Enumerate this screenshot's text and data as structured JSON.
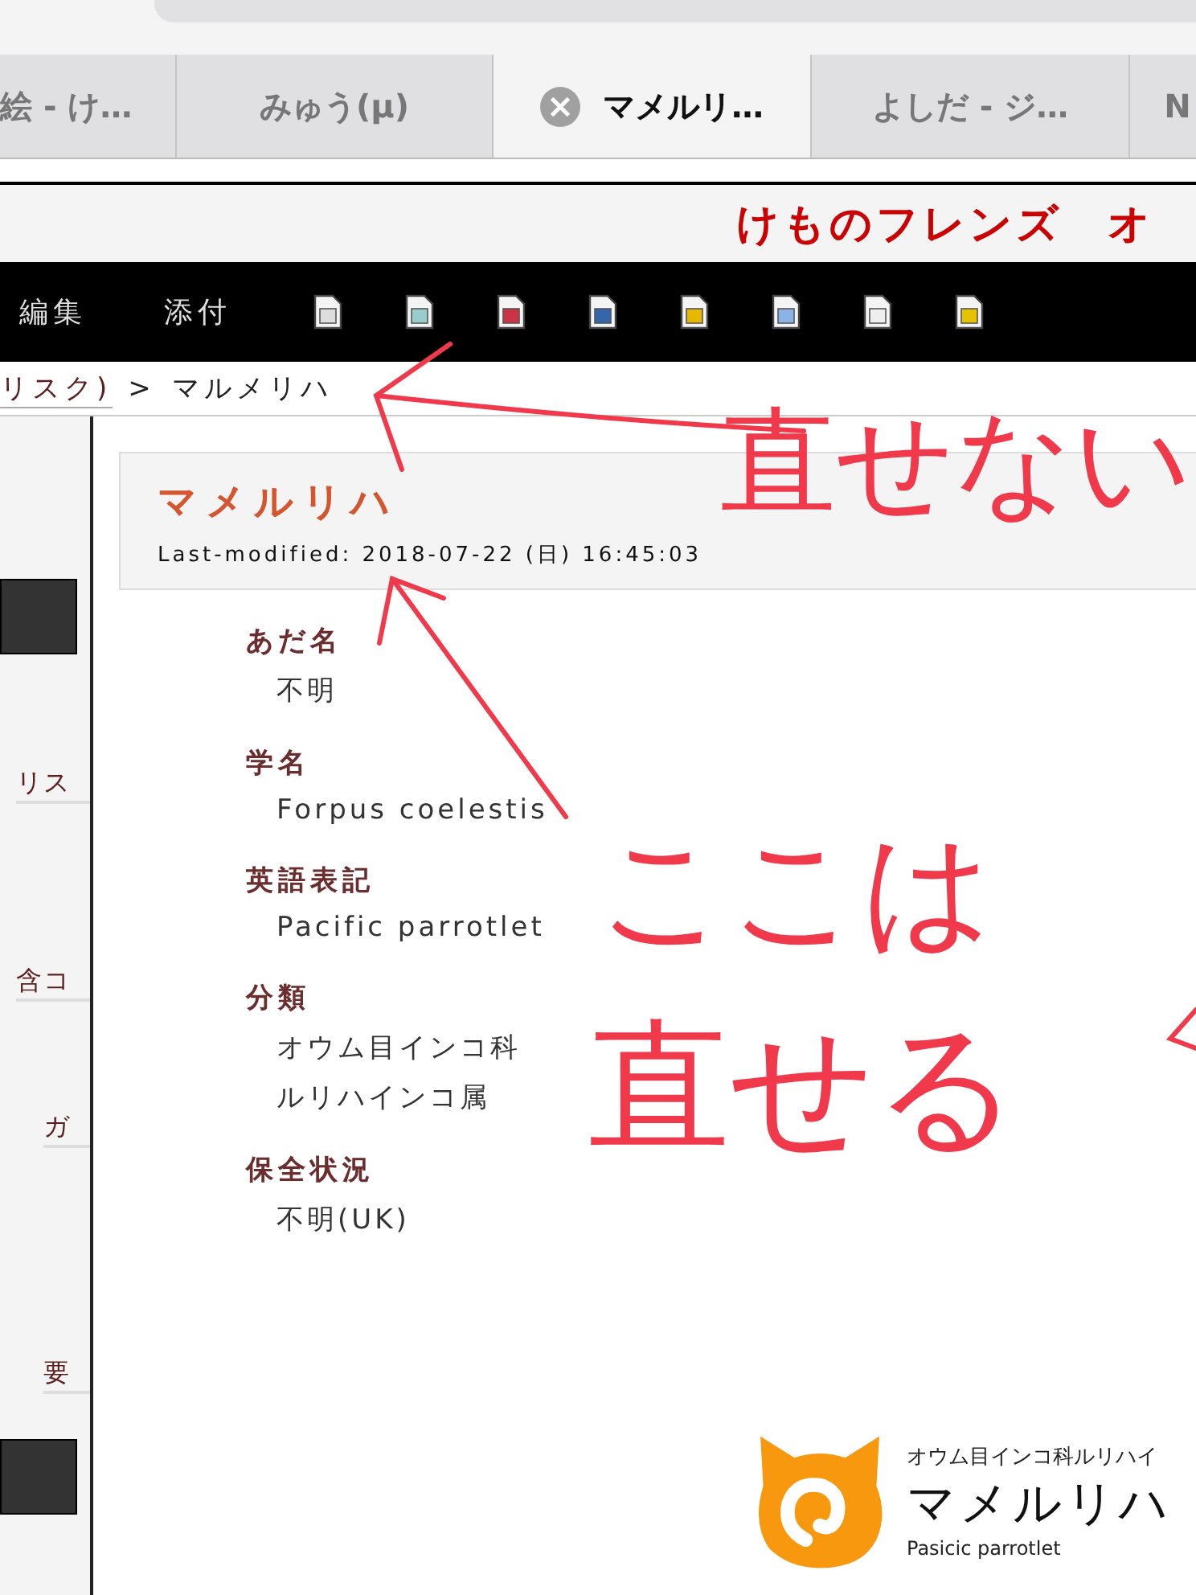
{
  "browser": {
    "tabs": [
      {
        "label": "絵 - け…",
        "selected": false
      },
      {
        "label": "みゅう(μ)",
        "selected": false
      },
      {
        "label": "マメルリ…",
        "selected": true
      },
      {
        "label": "よしだ - ジ…",
        "selected": false
      },
      {
        "label": "N",
        "selected": false
      }
    ]
  },
  "site": {
    "title": "けものフレンズ　オ"
  },
  "toolbar": {
    "items": [
      "編集",
      "添付"
    ]
  },
  "breadcrumb": {
    "link": "リスク)",
    "separator": ">",
    "current": "マルメリハ"
  },
  "sidebar": {
    "links": [
      "リス",
      "含コ",
      "ガ",
      "要"
    ]
  },
  "page": {
    "title": "マメルリハ",
    "last_modified": "Last-modified: 2018-07-22 (日) 16:45:03"
  },
  "fields": [
    {
      "label": "あだ名",
      "values": [
        "不明"
      ]
    },
    {
      "label": "学名",
      "values": [
        "Forpus coelestis"
      ]
    },
    {
      "label": "英語表記",
      "values": [
        "Pacific parrotlet"
      ]
    },
    {
      "label": "分類",
      "values": [
        "オウム目インコ科",
        "ルリハインコ属"
      ]
    },
    {
      "label": "保全状況",
      "values": [
        "不明(UK)"
      ]
    }
  ],
  "logo": {
    "caption": "オウム目インコ科ルリハイ",
    "name": "マメルリハ",
    "english": "Pasicic parrotlet"
  },
  "annotations": [
    {
      "text": "直せない"
    },
    {
      "text": "ここは"
    },
    {
      "text": "直せる"
    }
  ]
}
